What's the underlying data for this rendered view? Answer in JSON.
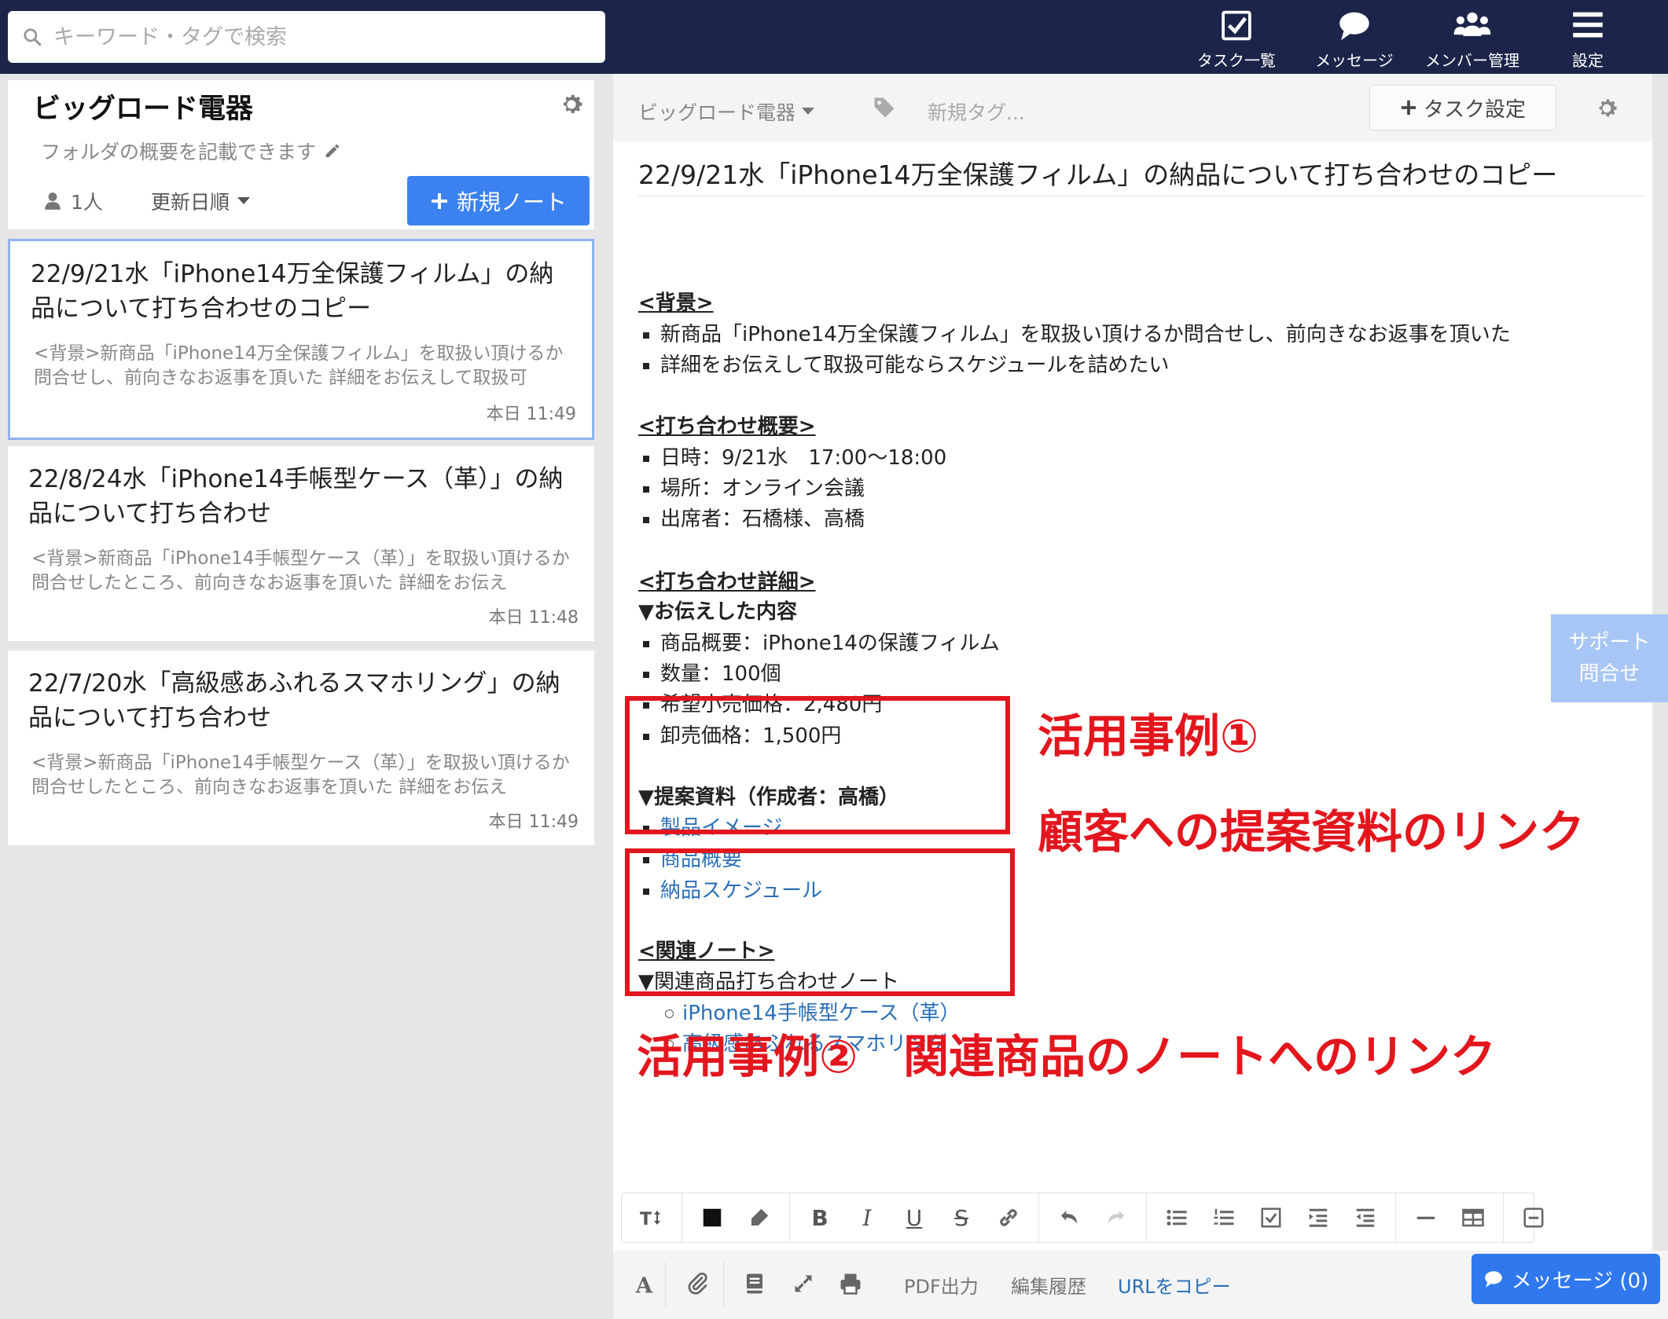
{
  "search": {
    "placeholder": "キーワード・タグで検索"
  },
  "nav": [
    {
      "label": "タスク一覧",
      "icon": "task-check-icon"
    },
    {
      "label": "メッセージ",
      "icon": "chat-bubble-icon"
    },
    {
      "label": "メンバー管理",
      "icon": "users-icon"
    },
    {
      "label": "設定",
      "icon": "menu-icon"
    }
  ],
  "folder": {
    "title": "ビッグロード電器",
    "description": "フォルダの概要を記載できます",
    "members": "1人",
    "sort": "更新日順",
    "new_note": "新規ノート"
  },
  "notes": [
    {
      "title": "22/9/21水「iPhone14万全保護フィルム」の納品について打ち合わせのコピー",
      "snippet": "<背景>新商品「iPhone14万全保護フィルム」を取扱い頂けるか問合せし、前向きなお返事を頂いた 詳細をお伝えして取扱可",
      "time": "本日 11:49"
    },
    {
      "title": "22/8/24水「iPhone14手帳型ケース（革）」の納品について打ち合わせ",
      "snippet": "<背景>新商品「iPhone14手帳型ケース（革）」を取扱い頂けるか問合せしたところ、前向きなお返事を頂いた 詳細をお伝え",
      "time": "本日 11:48"
    },
    {
      "title": "22/7/20水「高級感あふれるスマホリング」の納品について打ち合わせ",
      "snippet": "<背景>新商品「iPhone14手帳型ケース（革）」を取扱い頂けるか問合せしたところ、前向きなお返事を頂いた 詳細をお伝え",
      "time": "本日 11:49"
    }
  ],
  "editor": {
    "folder_crumb": "ビッグロード電器",
    "new_tag": "新規タグ...",
    "task_setting": "タスク設定",
    "title": "22/9/21水「iPhone14万全保護フィルム」の納品について打ち合わせのコピー",
    "body": {
      "h_background": "<背景>",
      "bg1": "新商品「iPhone14万全保護フィルム」を取扱い頂けるか問合せし、前向きなお返事を頂いた",
      "bg2": "詳細をお伝えして取扱可能ならスケジュールを詰めたい",
      "h_overview": "<打ち合わせ概要>",
      "ov1": "日時：9/21水　17:00～18:00",
      "ov2": "場所：オンライン会議",
      "ov3": "出席者：石橋様、高橋",
      "h_detail": "<打ち合わせ詳細>",
      "sub_told": "▼お伝えした内容",
      "d1": "商品概要：iPhone14の保護フィルム",
      "d2": "数量：100個",
      "d3": "希望小売価格：2,480円",
      "d4": "卸売価格：1,500円",
      "sub_proposal": "▼提案資料（作成者：高橋）",
      "link1": "製品イメージ",
      "link2": "商品概要",
      "link3": "納品スケジュール",
      "h_related": "<関連ノート>",
      "sub_related": "▼関連商品打ち合わせノート",
      "rlink1": "iPhone14手帳型ケース（革）",
      "rlink2": "高級感あふれるスマホリング"
    }
  },
  "annotations": {
    "a1_line1": "活用事例①",
    "a1_line2": "顧客への提案資料のリンク",
    "a2": "活用事例②　関連商品のノートへのリンク",
    "color": "#e3161e"
  },
  "support": {
    "line1": "サポート",
    "line2": "問合せ"
  },
  "format_toolbar": {
    "bold": "B",
    "italic": "I",
    "underline": "U",
    "strike": "S"
  },
  "bottom": {
    "pdf": "PDF出力",
    "history": "編集履歴",
    "copy_url": "URLをコピー",
    "message": "メッセージ (0)"
  },
  "colors": {
    "header": "#1c2549",
    "primary": "#3b82f0",
    "link": "#2a6fb8"
  }
}
